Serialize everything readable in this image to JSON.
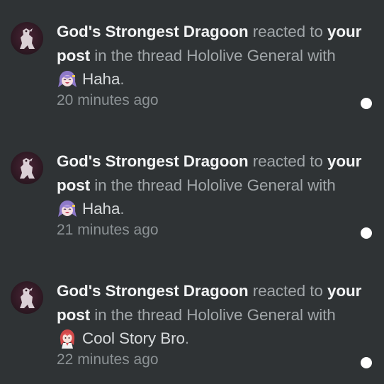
{
  "notifications": [
    {
      "actor": "God's Strongest Dragoon",
      "verb": " reacted to ",
      "object": "your post",
      "middle": " in the thread ",
      "thread": "Hololive General",
      "with": " with",
      "reaction_icon": "purple-hair-anime-girl-laughing-icon",
      "reaction_label": "Haha",
      "reaction_suffix": ".",
      "time": "20 minutes ago",
      "unread": true
    },
    {
      "actor": "God's Strongest Dragoon",
      "verb": " reacted to ",
      "object": "your post",
      "middle": " in the thread ",
      "thread": "Hololive General",
      "with": " with",
      "reaction_icon": "purple-hair-anime-girl-laughing-icon",
      "reaction_label": "Haha",
      "reaction_suffix": ".",
      "time": "21 minutes ago",
      "unread": true
    },
    {
      "actor": "God's Strongest Dragoon",
      "verb": " reacted to ",
      "object": "your post",
      "middle": " in the thread ",
      "thread": "Hololive General",
      "with": " with",
      "reaction_icon": "red-hair-anime-girl-icon",
      "reaction_label": "Cool Story Bro",
      "reaction_suffix": ".",
      "time": "22 minutes ago",
      "unread": true
    }
  ],
  "colors": {
    "background": "#2f3335",
    "text_strong": "#f2f3f4",
    "text_muted": "#a2a7aa",
    "unread_dot": "#ffffff"
  }
}
